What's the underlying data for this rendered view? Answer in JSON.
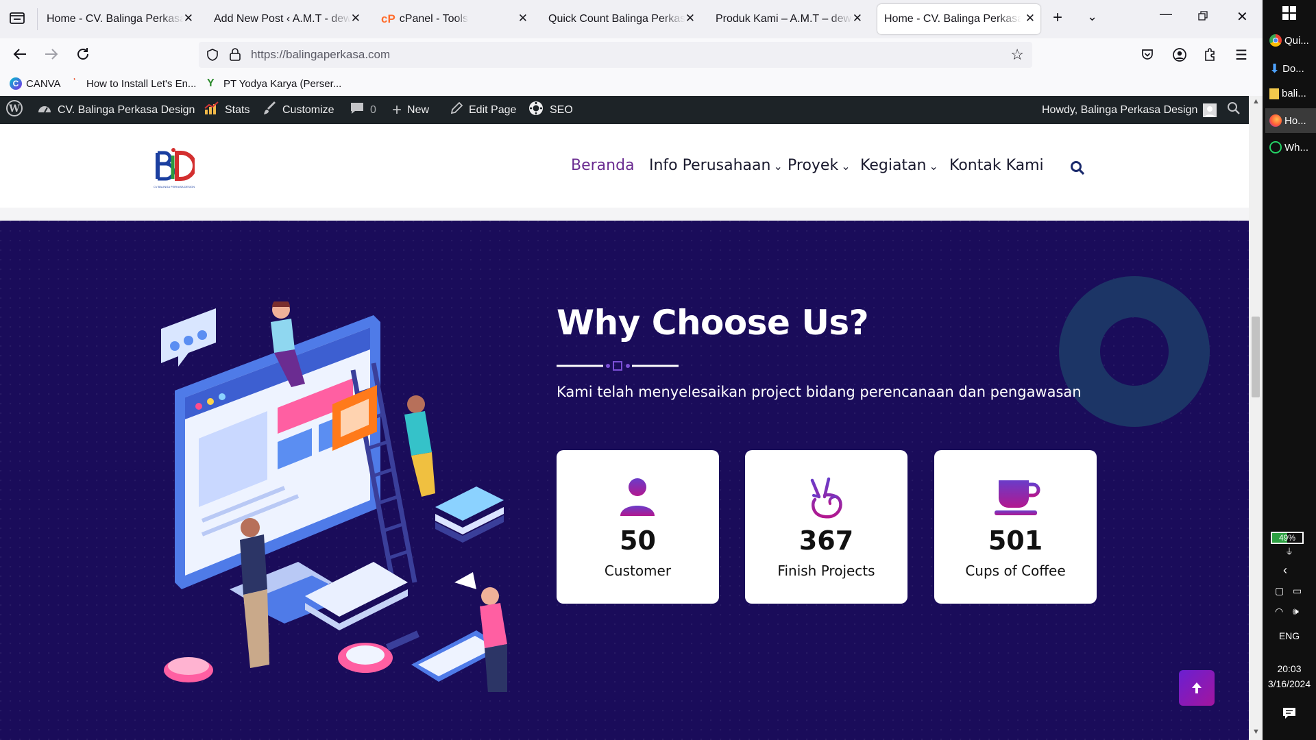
{
  "browser": {
    "tabs": [
      {
        "title": "Home - CV. Balinga Perkasa Design",
        "active": false
      },
      {
        "title": "Add New Post ‹ A.M.T - dewadaru",
        "active": false
      },
      {
        "title": "cPanel - Tools",
        "active": false
      },
      {
        "title": "Quick Count Balinga Perkasa Design",
        "active": false
      },
      {
        "title": "Produk Kami – A.M.T – dewadaru",
        "active": false
      },
      {
        "title": "Home - CV. Balinga Perkasa Design",
        "active": true
      }
    ],
    "url": "https://balingaperkasa.com",
    "bookmarks": [
      {
        "label": "CANVA",
        "icon": "canva-icon"
      },
      {
        "label": "How to Install Let's En...",
        "icon": "bookmark-site-icon"
      },
      {
        "label": "PT Yodya Karya (Perser...",
        "icon": "yodya-icon"
      }
    ]
  },
  "adminbar": {
    "site_name": "CV. Balinga Perkasa Design",
    "stats": "Stats",
    "customize": "Customize",
    "comments_count": "0",
    "new": "New",
    "edit_page": "Edit Page",
    "seo": "SEO",
    "howdy": "Howdy, Balinga Perkasa Design"
  },
  "site": {
    "logo_text": "BPD",
    "logo_caption": "CV BALINGA PERKASA DESIGN",
    "menu": [
      {
        "label": "Beranda",
        "active": true,
        "dropdown": false
      },
      {
        "label": "Info Perusahaan",
        "active": false,
        "dropdown": true
      },
      {
        "label": "Proyek",
        "active": false,
        "dropdown": true
      },
      {
        "label": "Kegiatan",
        "active": false,
        "dropdown": true
      },
      {
        "label": "Kontak Kami",
        "active": false,
        "dropdown": false
      }
    ]
  },
  "hero": {
    "title": "Why Choose Us?",
    "subtitle": "Kami telah menyelesaikan project bidang perencanaan dan pengawasan",
    "stats": [
      {
        "value": "50",
        "label": "Customer",
        "icon": "user-icon"
      },
      {
        "value": "367",
        "label": "Finish Projects",
        "icon": "peace-hand-icon"
      },
      {
        "value": "501",
        "label": "Cups of Coffee",
        "icon": "coffee-cup-icon"
      }
    ]
  },
  "taskbar": {
    "apps": [
      {
        "label": "Qui...",
        "icon": "chrome-icon"
      },
      {
        "label": "Do...",
        "icon": "download-icon"
      },
      {
        "label": "bali...",
        "icon": "folder-icon"
      },
      {
        "label": "Ho...",
        "icon": "firefox-icon"
      },
      {
        "label": "Wh...",
        "icon": "whatsapp-icon"
      }
    ],
    "battery": "49%",
    "language": "ENG",
    "time": "20:03",
    "date": "3/16/2024"
  },
  "colors": {
    "hero_bg": "#1a0c5a",
    "accent_purple": "#7b2d9c",
    "menu_active": "#6b2c91",
    "adminbar_bg": "#1d2327"
  }
}
